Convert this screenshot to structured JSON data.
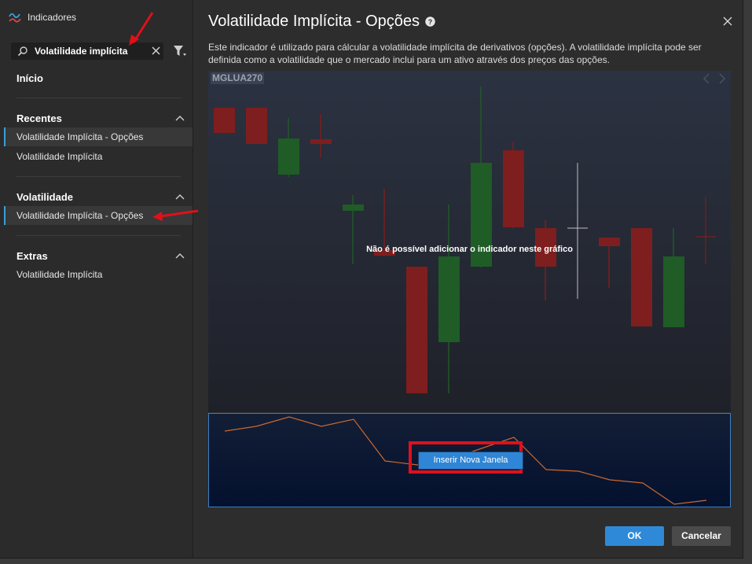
{
  "app": {
    "title": "Indicadores",
    "icon": "indicator-chart-icon"
  },
  "search": {
    "value": "Volatilidade implícita",
    "icon": "search-icon",
    "clear_icon": "close-icon"
  },
  "filter": {
    "icon": "filter-icon"
  },
  "sidebar": {
    "home": "Início",
    "sections": [
      {
        "title": "Recentes",
        "items": [
          {
            "label": "Volatilidade Implícita - Opções",
            "active": true
          },
          {
            "label": "Volatilidade Implícita",
            "active": false
          }
        ]
      },
      {
        "title": "Volatilidade",
        "items": [
          {
            "label": "Volatilidade Implícita - Opções",
            "active": true
          }
        ]
      },
      {
        "title": "Extras",
        "items": [
          {
            "label": "Volatilidade Implícita",
            "active": false
          }
        ]
      }
    ]
  },
  "main": {
    "title": "Volatilidade Implícita - Opções",
    "description": "Este indicador é utilizado para cálcular a volatilidade implícita de derivativos (opções). A volatilidade implícita pode ser definida como a volatilidade que o mercado inclui para um ativo através dos preços das opções.",
    "chart": {
      "ticker": "MGLUA270",
      "message": "Não é possível adicionar o indicador neste gráfico",
      "insert_button": "Inserir Nova Janela"
    }
  },
  "footer": {
    "ok": "OK",
    "cancel": "Cancelar"
  },
  "colors": {
    "accent": "#2e8ad8",
    "candle_up": "#1f5c26",
    "candle_down": "#7f1e1e",
    "indicator_line": "#c9682f",
    "annotation": "#e0101a"
  }
}
